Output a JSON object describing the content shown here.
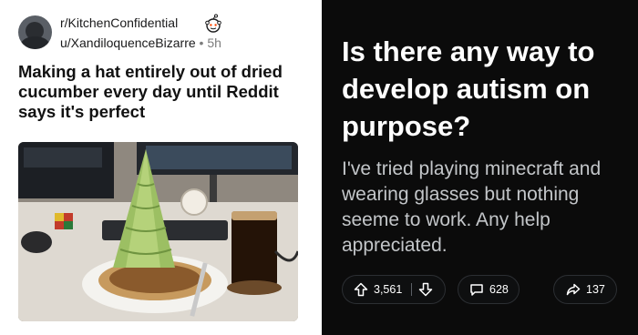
{
  "post": {
    "subreddit": "r/KitchenConfidential",
    "username": "u/XandiloquenceBizarre",
    "separator": "•",
    "age": "5h",
    "title": "Making a hat entirely out of dried cucumber every day until Reddit says it's perfect"
  },
  "question": {
    "title": "Is there any way to develop autism on purpose?",
    "body": "I've tried playing minecraft and wearing glasses but nothing seeme to work. Any help appreciated.",
    "upvotes": "3,561",
    "comments": "628",
    "shares": "137"
  },
  "icons": {
    "upvote": "upvote-arrow-icon",
    "downvote": "downvote-arrow-icon",
    "comment": "comment-bubble-icon",
    "share": "share-arrow-icon",
    "snoo": "reddit-snoo-icon"
  },
  "colors": {
    "left_background": "#ffffff",
    "right_background": "#0b0b0b",
    "question_text": "#ffffff",
    "body_text": "#c3c6c9"
  }
}
